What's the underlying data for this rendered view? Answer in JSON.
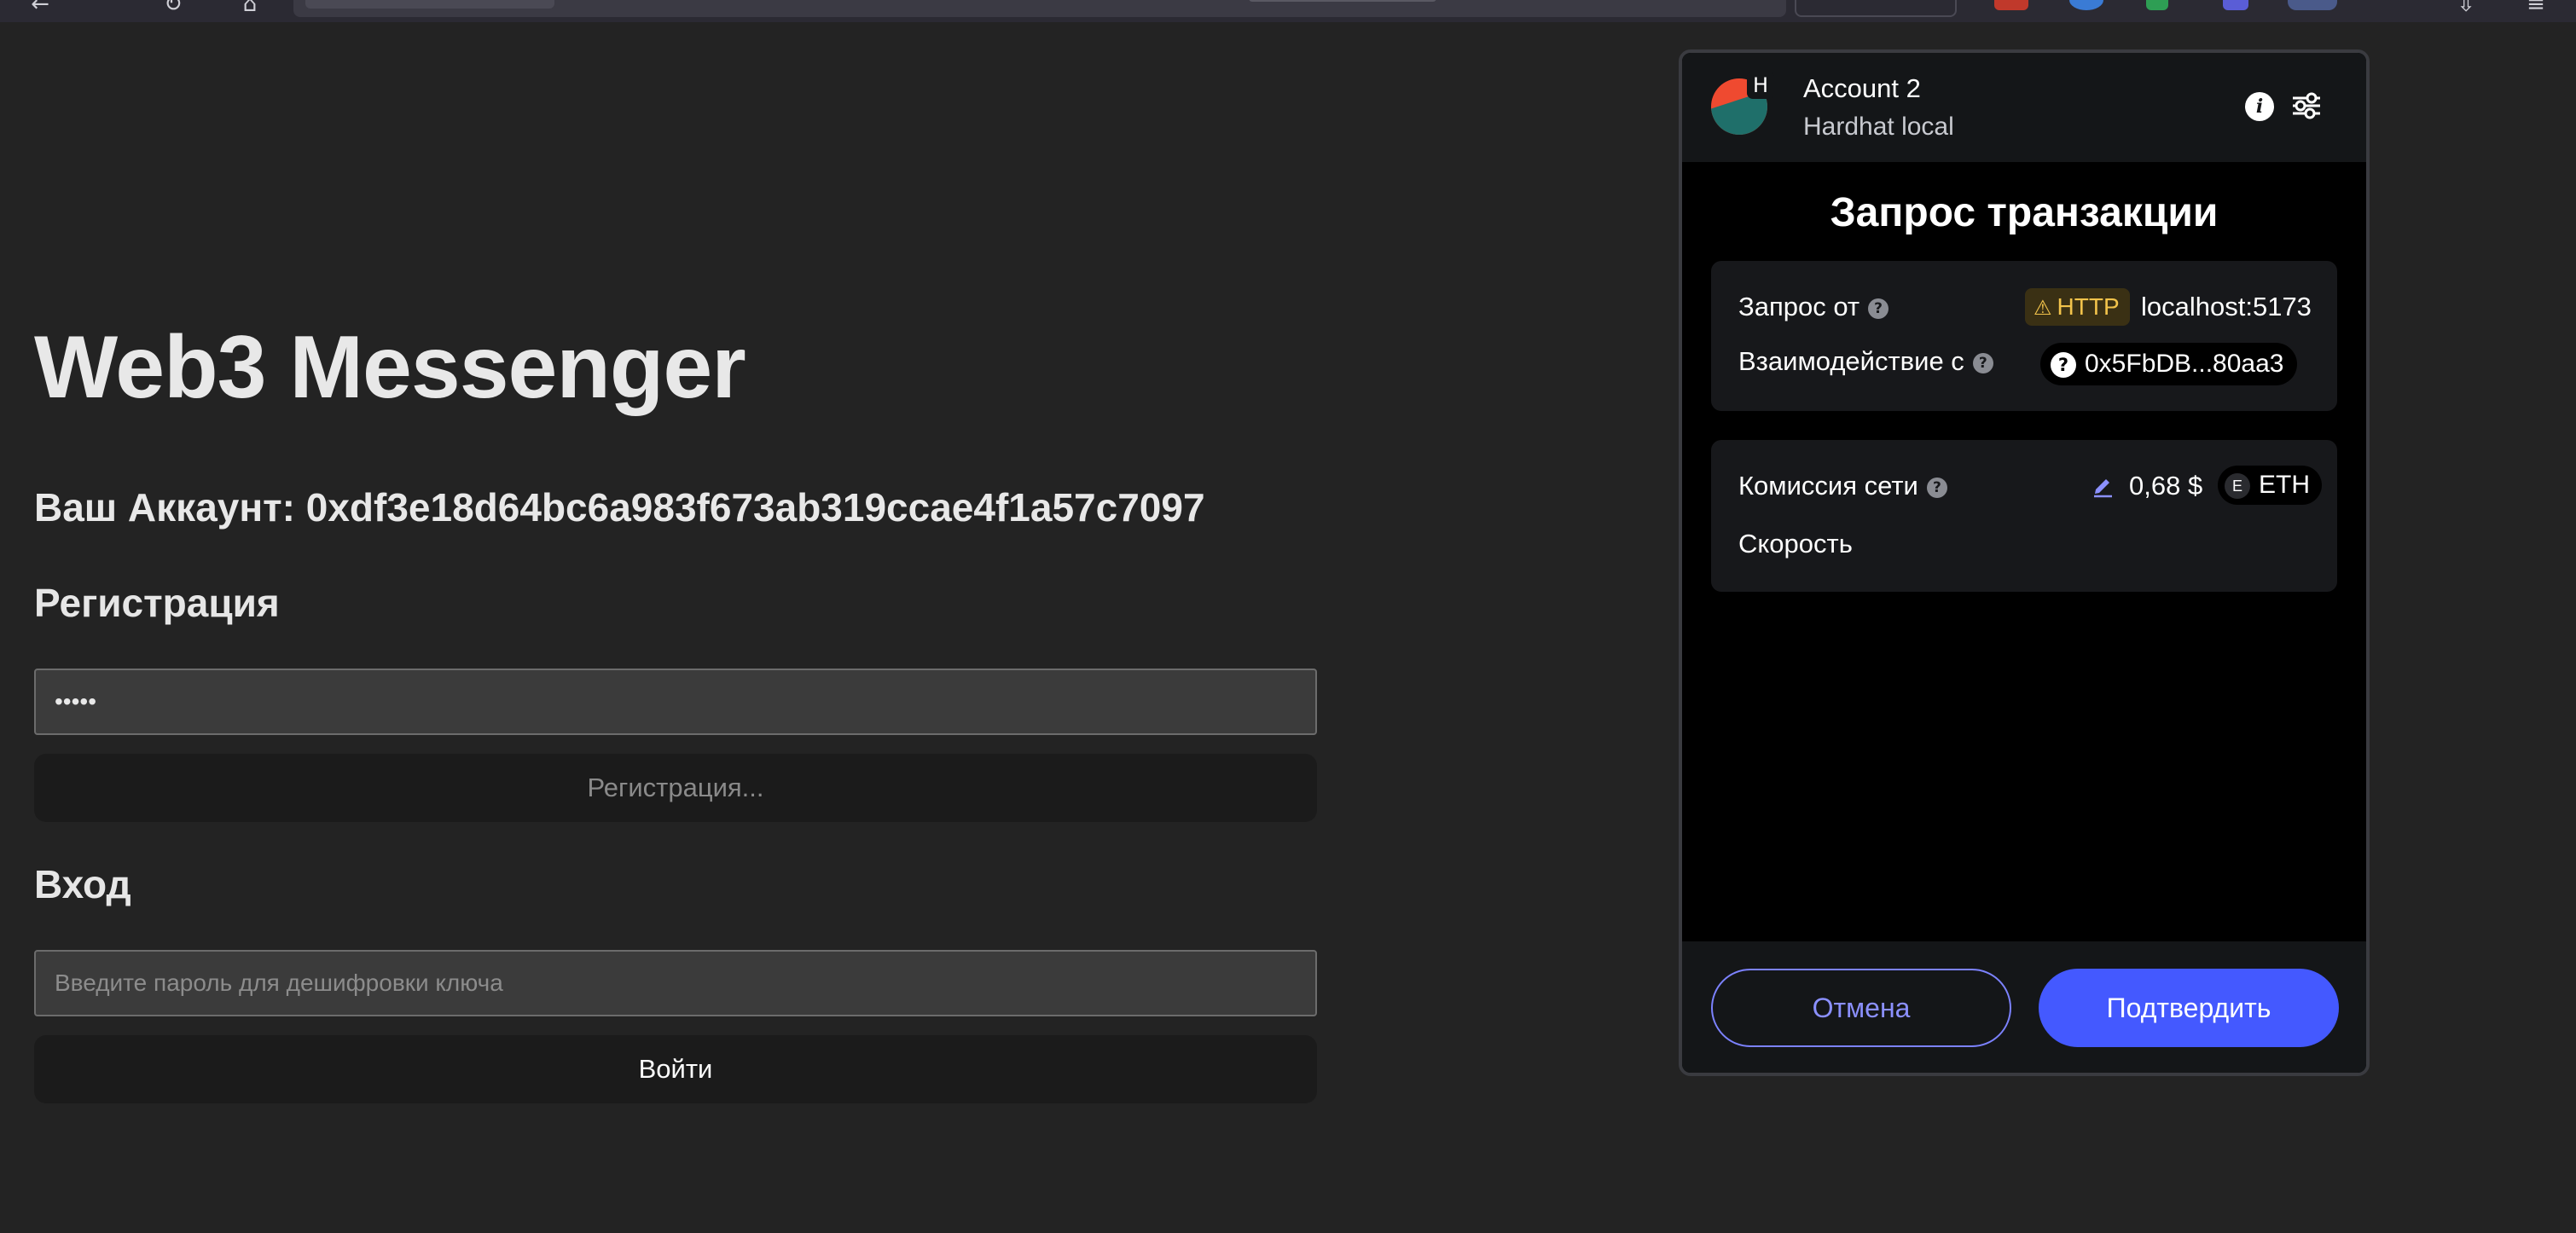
{
  "app": {
    "title": "Web3 Messenger",
    "account_label": "Ваш Аккаунт: 0xdf3e18d64bc6a983f673ab319ccae4f1a57c7097"
  },
  "register": {
    "heading": "Регистрация",
    "password_value": "•••••",
    "button_label": "Регистрация...",
    "button_color": "#8a8a8a"
  },
  "login": {
    "heading": "Вход",
    "password_placeholder": "Введите пароль для дешифровки ключа",
    "button_label": "Войти",
    "button_color": "#ffffff"
  },
  "wallet_popup": {
    "account_name": "Account 2",
    "network_name": "Hardhat local",
    "network_badge": "H",
    "title": "Запрос транзакции",
    "request_from": {
      "label": "Запрос от",
      "protocol_badge": "HTTP",
      "origin": "localhost:5173"
    },
    "interacting_with": {
      "label": "Взаимодействие с",
      "address": "0x5FbDB...80aa3"
    },
    "fee": {
      "label": "Комиссия сети",
      "value": "0,68 $",
      "token_symbol": "ETH",
      "token_letter": "E"
    },
    "speed": {
      "label": "Скорость"
    },
    "buttons": {
      "cancel": "Отмена",
      "confirm": "Подтвердить"
    },
    "colors": {
      "accent": "#4459ff",
      "warning": "#f2c34b"
    }
  }
}
